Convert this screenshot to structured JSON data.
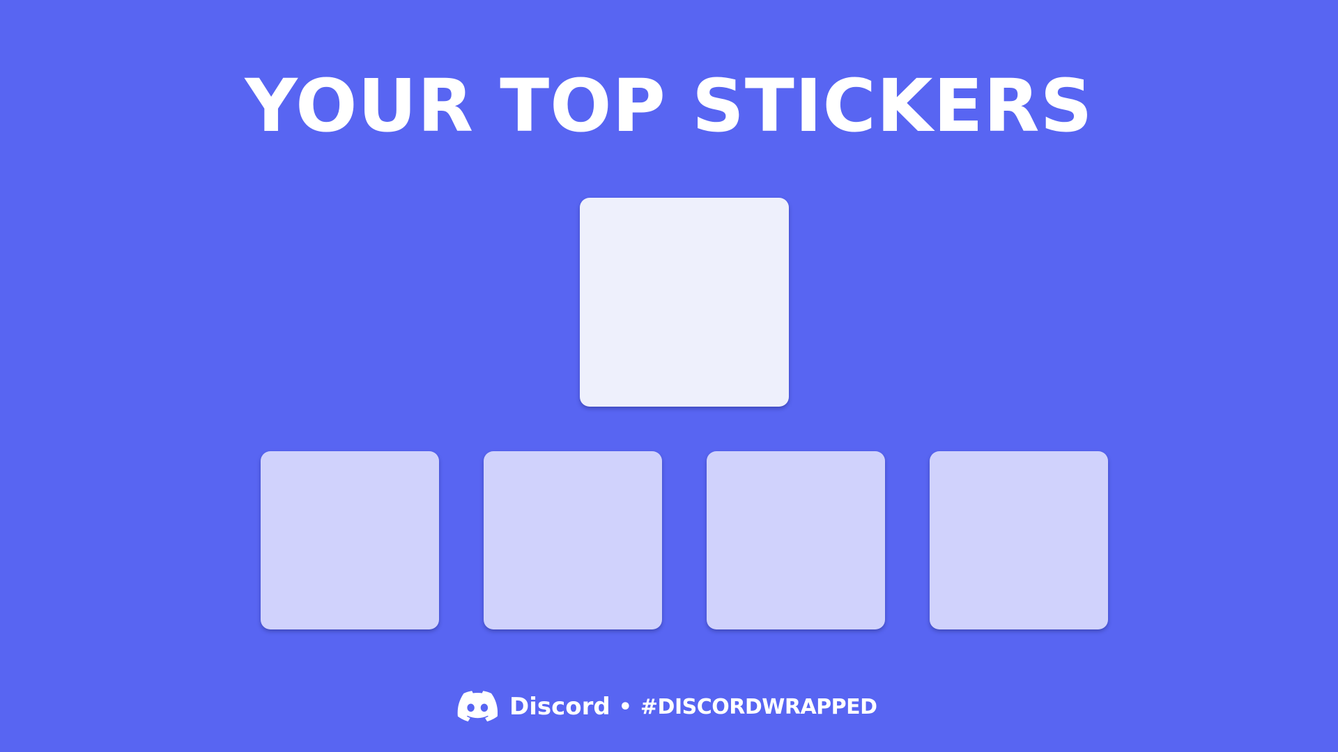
{
  "title": "YOUR TOP STICKERS",
  "colors": {
    "background": "#5865F2",
    "top_sticker": "#EEF0FC",
    "small_sticker": "#D0D2FC",
    "text": "#FFFFFF"
  },
  "footer": {
    "logo_icon": "discord-logo-icon",
    "brand": "Discord",
    "separator": "•",
    "hashtag": "#DISCORDWRAPPED"
  }
}
